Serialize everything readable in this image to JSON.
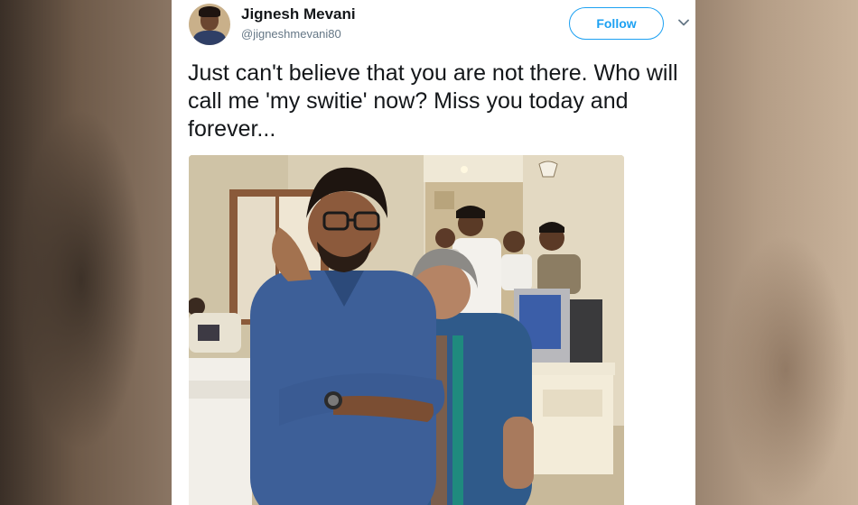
{
  "tweet": {
    "author_name": "Jignesh Mevani",
    "author_handle": "@jigneshmevani80",
    "follow_label": "Follow",
    "text": "Just can't believe that you are not there. Who will call me 'my switie' now? Miss you today and forever...",
    "menu_icon": "chevron-down-icon",
    "avatar_icon": "profile-photo"
  },
  "colors": {
    "accent": "#1da1f2",
    "text_primary": "#14171a",
    "text_secondary": "#657786"
  }
}
